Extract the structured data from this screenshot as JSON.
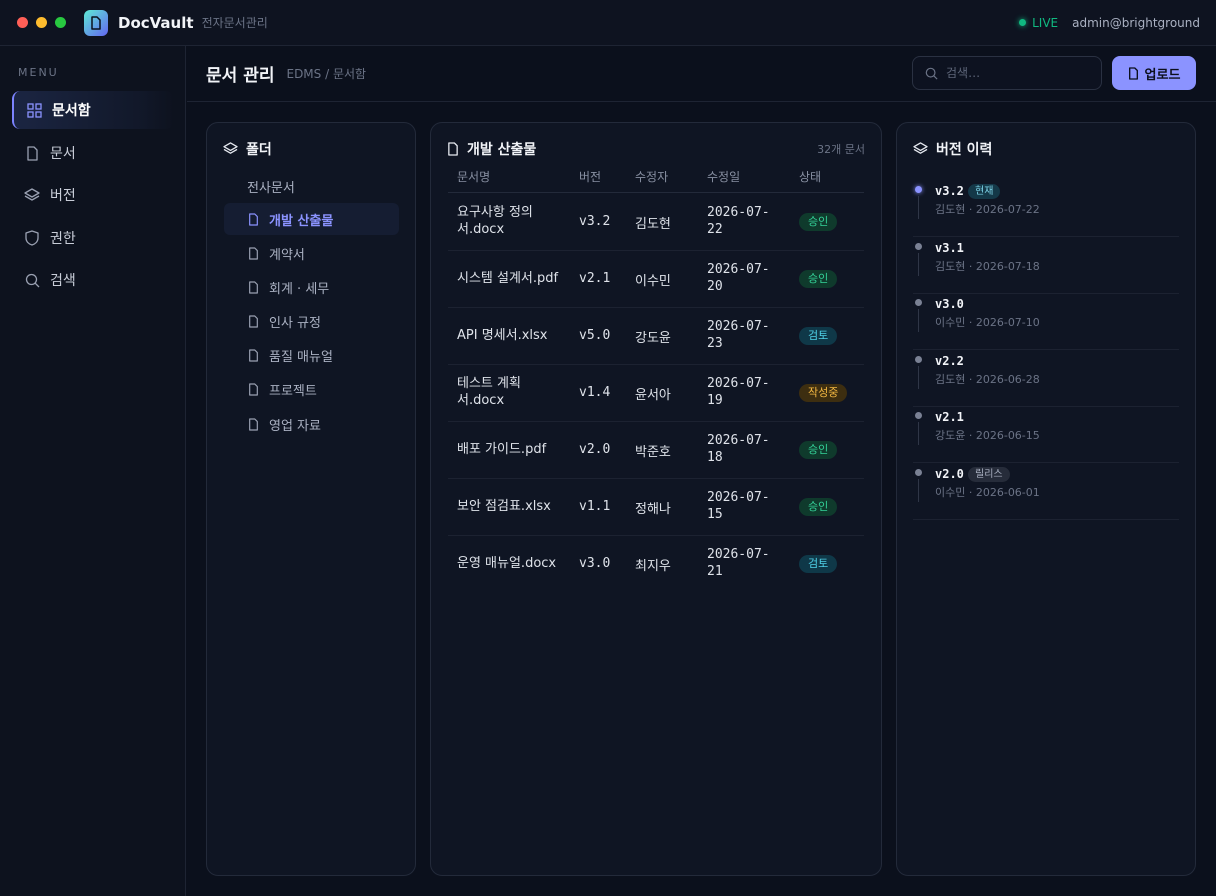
{
  "app": {
    "name": "DocVault",
    "subtitle": "전자문서관리",
    "live": "LIVE",
    "user": "admin@brightground"
  },
  "colors": {
    "accent": "#8b93ff",
    "background": "#0b101c",
    "live": "#10b981",
    "approved": "#34d399",
    "review": "#4fd1e8",
    "draft": "#f5b942"
  },
  "sidebar": {
    "heading": "MENU",
    "items": [
      {
        "label": "문서함",
        "icon": "grid-icon",
        "active": true
      },
      {
        "label": "문서",
        "icon": "file-icon",
        "active": false
      },
      {
        "label": "버전",
        "icon": "layers-icon",
        "active": false
      },
      {
        "label": "권한",
        "icon": "shield-icon",
        "active": false
      },
      {
        "label": "검색",
        "icon": "search-icon",
        "active": false
      }
    ]
  },
  "header": {
    "title": "문서 관리",
    "breadcrumb": "EDMS / 문서함",
    "search_placeholder": "검색…",
    "upload_label": "업로드"
  },
  "folders": {
    "title": "폴더",
    "root": "전사문서",
    "items": [
      {
        "label": "개발 산출물",
        "active": true
      },
      {
        "label": "계약서",
        "active": false
      },
      {
        "label": "회계 · 세무",
        "active": false
      },
      {
        "label": "인사 규정",
        "active": false
      },
      {
        "label": "품질 매뉴얼",
        "active": false
      },
      {
        "label": "프로젝트",
        "active": false
      },
      {
        "label": "영업 자료",
        "active": false
      }
    ]
  },
  "documents": {
    "title": "개발 산출물",
    "count": "32개 문서",
    "columns": [
      "문서명",
      "버전",
      "수정자",
      "수정일",
      "상태"
    ],
    "rows": [
      {
        "name": "요구사항 정의서.docx",
        "version": "v3.2",
        "author": "김도현",
        "date": "2026-07-22",
        "status": "승인",
        "status_type": "green"
      },
      {
        "name": "시스템 설계서.pdf",
        "version": "v2.1",
        "author": "이수민",
        "date": "2026-07-20",
        "status": "승인",
        "status_type": "green"
      },
      {
        "name": "API 명세서.xlsx",
        "version": "v5.0",
        "author": "강도윤",
        "date": "2026-07-23",
        "status": "검토",
        "status_type": "blue"
      },
      {
        "name": "테스트 계획서.docx",
        "version": "v1.4",
        "author": "윤서아",
        "date": "2026-07-19",
        "status": "작성중",
        "status_type": "amber"
      },
      {
        "name": "배포 가이드.pdf",
        "version": "v2.0",
        "author": "박준호",
        "date": "2026-07-18",
        "status": "승인",
        "status_type": "green"
      },
      {
        "name": "보안 점검표.xlsx",
        "version": "v1.1",
        "author": "정해나",
        "date": "2026-07-15",
        "status": "승인",
        "status_type": "green"
      },
      {
        "name": "운영 매뉴얼.docx",
        "version": "v3.0",
        "author": "최지우",
        "date": "2026-07-21",
        "status": "검토",
        "status_type": "blue"
      }
    ]
  },
  "versions": {
    "title": "버전 이력",
    "items": [
      {
        "version": "v3.2",
        "meta": "김도현 · 2026-07-22",
        "tag": "현재",
        "tag_type": "current"
      },
      {
        "version": "v3.1",
        "meta": "김도현 · 2026-07-18",
        "tag": "",
        "tag_type": ""
      },
      {
        "version": "v3.0",
        "meta": "이수민 · 2026-07-10",
        "tag": "",
        "tag_type": ""
      },
      {
        "version": "v2.2",
        "meta": "김도현 · 2026-06-28",
        "tag": "",
        "tag_type": ""
      },
      {
        "version": "v2.1",
        "meta": "강도윤 · 2026-06-15",
        "tag": "",
        "tag_type": ""
      },
      {
        "version": "v2.0",
        "meta": "이수민 · 2026-06-01",
        "tag": "릴리스",
        "tag_type": "release"
      }
    ]
  }
}
